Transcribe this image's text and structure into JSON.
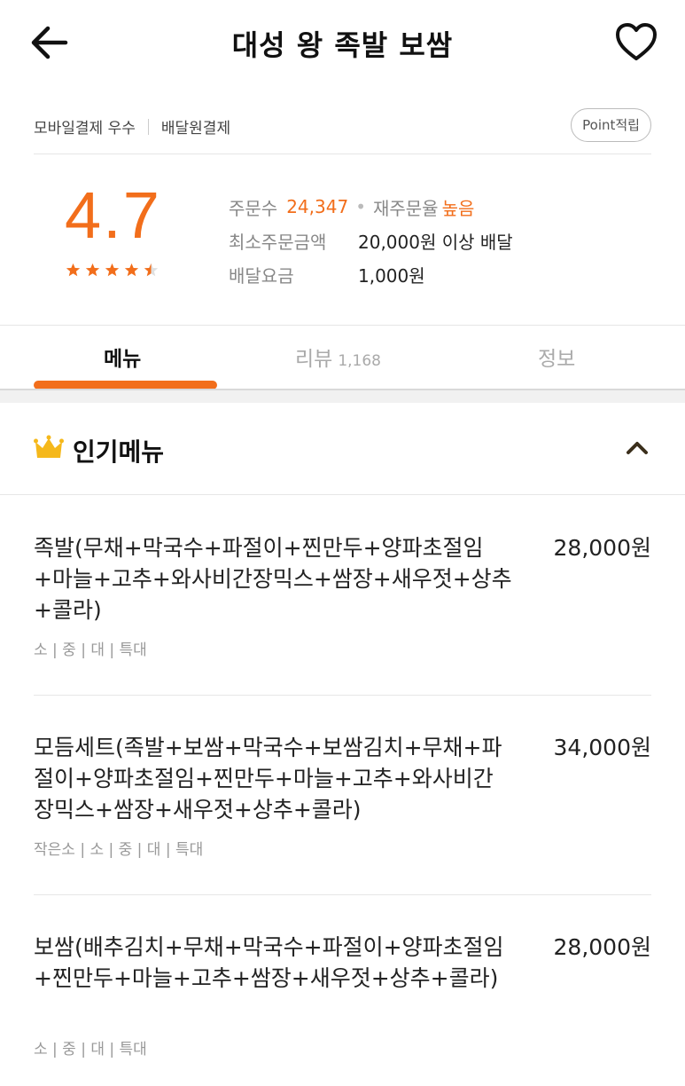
{
  "header": {
    "title": "대성 왕 족발 보쌈",
    "back_icon": "arrow-left-icon",
    "favorite_icon": "heart-outline-icon"
  },
  "payment": {
    "tags": [
      "모바일결제 우수",
      "배달원결제"
    ],
    "point_badge": "Point적립"
  },
  "rating": {
    "score": "4.7",
    "stars": 4.5
  },
  "stats": {
    "orders_label": "주문수",
    "orders_value": "24,347",
    "reorder_label": "재주문율",
    "reorder_value": "높음",
    "min_order_label": "최소주문금액",
    "min_order_value": "20,000원 이상 배달",
    "delivery_fee_label": "배달요금",
    "delivery_fee_value": "1,000원"
  },
  "tabs": {
    "menu": "메뉴",
    "review": "리뷰",
    "review_count": "1,168",
    "info": "정보"
  },
  "popular": {
    "title": "인기메뉴",
    "crown_icon": "crown-icon",
    "collapse_icon": "chevron-up-icon"
  },
  "menu_items": [
    {
      "name": "족발(무채+막국수+파절이+찐만두+양파초절임+마늘+고추+와사비간장믹스+쌈장+새우젓+상추+콜라)",
      "price": "28,000원",
      "sizes": "소 | 중 | 대 | 특대"
    },
    {
      "name": "모듬세트(족발+보쌈+막국수+보쌈김치+무채+파절이+양파초절임+찐만두+마늘+고추+와사비간장믹스+쌈장+새우젓+상추+콜라)",
      "price": "34,000원",
      "sizes": "작은소 | 소 | 중 | 대 | 특대"
    },
    {
      "name": "보쌈(배추김치+무채+막국수+파절이+양파초절임+찐만두+마늘+고추+쌈장+새우젓+상추+콜라)",
      "price": "28,000원",
      "sizes": "소 | 중 | 대 | 특대"
    }
  ],
  "colors": {
    "accent": "#f26e1b",
    "crown": "#f5b81b"
  }
}
